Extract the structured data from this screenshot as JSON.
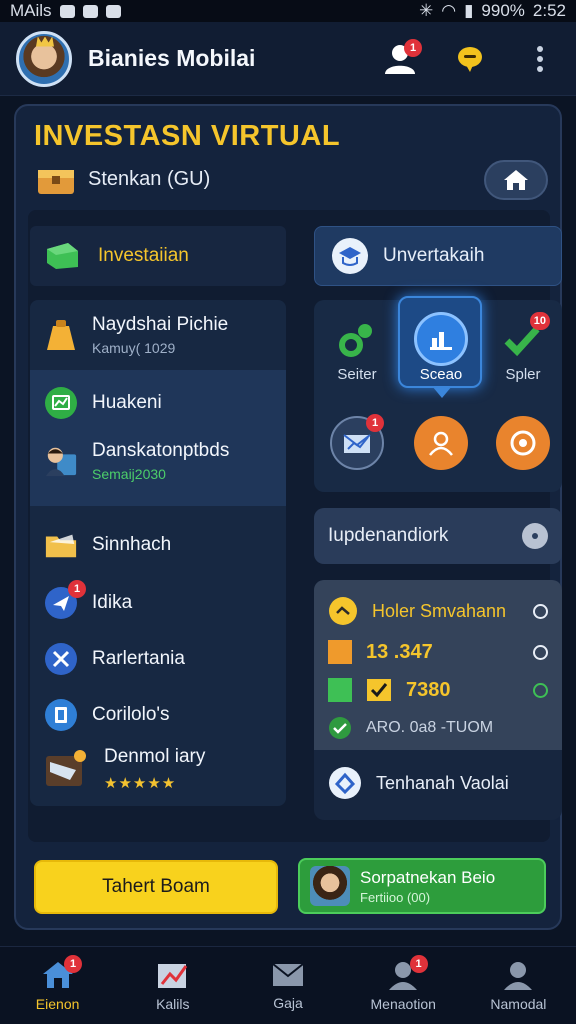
{
  "status_bar": {
    "carrier": "MAils",
    "battery": "990%",
    "time": "2:52"
  },
  "app_bar": {
    "title": "Bianies Mobilai",
    "notifications_badge": "1"
  },
  "panel": {
    "title": "INVESTASN VIRTUAL",
    "subtitle": "Stenkan (GU)"
  },
  "left": {
    "header": "Investaiian",
    "items": [
      {
        "title": "Naydshai Pichie",
        "subtitle": "Kamuy( 1029"
      },
      {
        "title": "Huakeni"
      },
      {
        "title": "Danskatonptbds",
        "subtitle": "Semaij2030"
      },
      {
        "title": "Sinnhach"
      },
      {
        "title": "Idika",
        "badge": "1"
      },
      {
        "title": "Rarlertania"
      },
      {
        "title": "Corilolo's"
      },
      {
        "title": "Denmol iary",
        "rating": "★★★★★"
      }
    ]
  },
  "right": {
    "header": "Unvertakaih",
    "grid": [
      {
        "label": "Seiter"
      },
      {
        "label": "Sceao"
      },
      {
        "label": "Spler",
        "badge": "10"
      },
      {
        "label": "",
        "badge": "1"
      },
      {
        "label": ""
      },
      {
        "label": ""
      }
    ],
    "dropdown": "Iupdenandiork",
    "stats": {
      "name": "Holer Smvahann",
      "value1": "13 .347",
      "value2": "7380",
      "footer": "ARO. 0a8 -TUOM"
    },
    "footer_link": "Tenhanah Vaolai"
  },
  "buttons": {
    "yellow": "Tahert Boam",
    "green_title": "Sorpatnekan Beio",
    "green_sub": "Fertiioo (00)"
  },
  "nav": [
    {
      "label": "Eienon",
      "badge": "1"
    },
    {
      "label": "Kalils"
    },
    {
      "label": "Gaja"
    },
    {
      "label": "Menaotion",
      "badge": "1"
    },
    {
      "label": "Namodal"
    }
  ],
  "colors": {
    "accent": "#f5c52c",
    "panel": "#14233d",
    "green": "#2d9d3c",
    "badge": "#e0323a"
  }
}
